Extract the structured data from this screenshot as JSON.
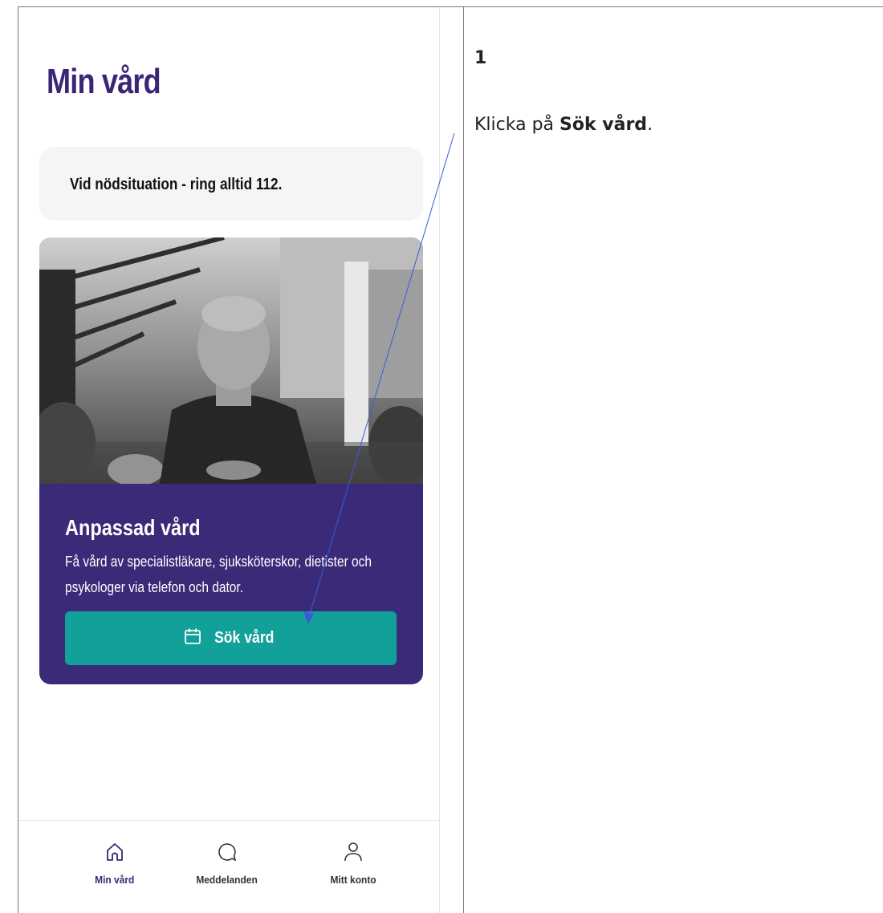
{
  "app": {
    "page_title": "Min vård",
    "emergency_notice": "Vid nödsituation - ring alltid 112.",
    "care_card": {
      "title": "Anpassad vård",
      "description": "Få vård av specialistläkare, sjuksköterskor, dietister och psykologer via telefon och dator.",
      "button_label": "Sök vård",
      "button_icon": "calendar-icon"
    },
    "bottom_nav": [
      {
        "label": "Min vård",
        "icon": "home-icon",
        "active": true
      },
      {
        "label": "Meddelanden",
        "icon": "chat-bubble-icon",
        "active": false
      },
      {
        "label": "Mitt konto",
        "icon": "person-icon",
        "active": false
      }
    ]
  },
  "instructions": {
    "step_number": "1",
    "text_prefix": "Klicka på ",
    "text_bold": "Sök vård",
    "text_suffix": "."
  },
  "colors": {
    "brand_purple": "#3b2577",
    "card_purple": "#3b2a78",
    "button_teal": "#12a19a",
    "callout_line": "#3b5bd6"
  }
}
